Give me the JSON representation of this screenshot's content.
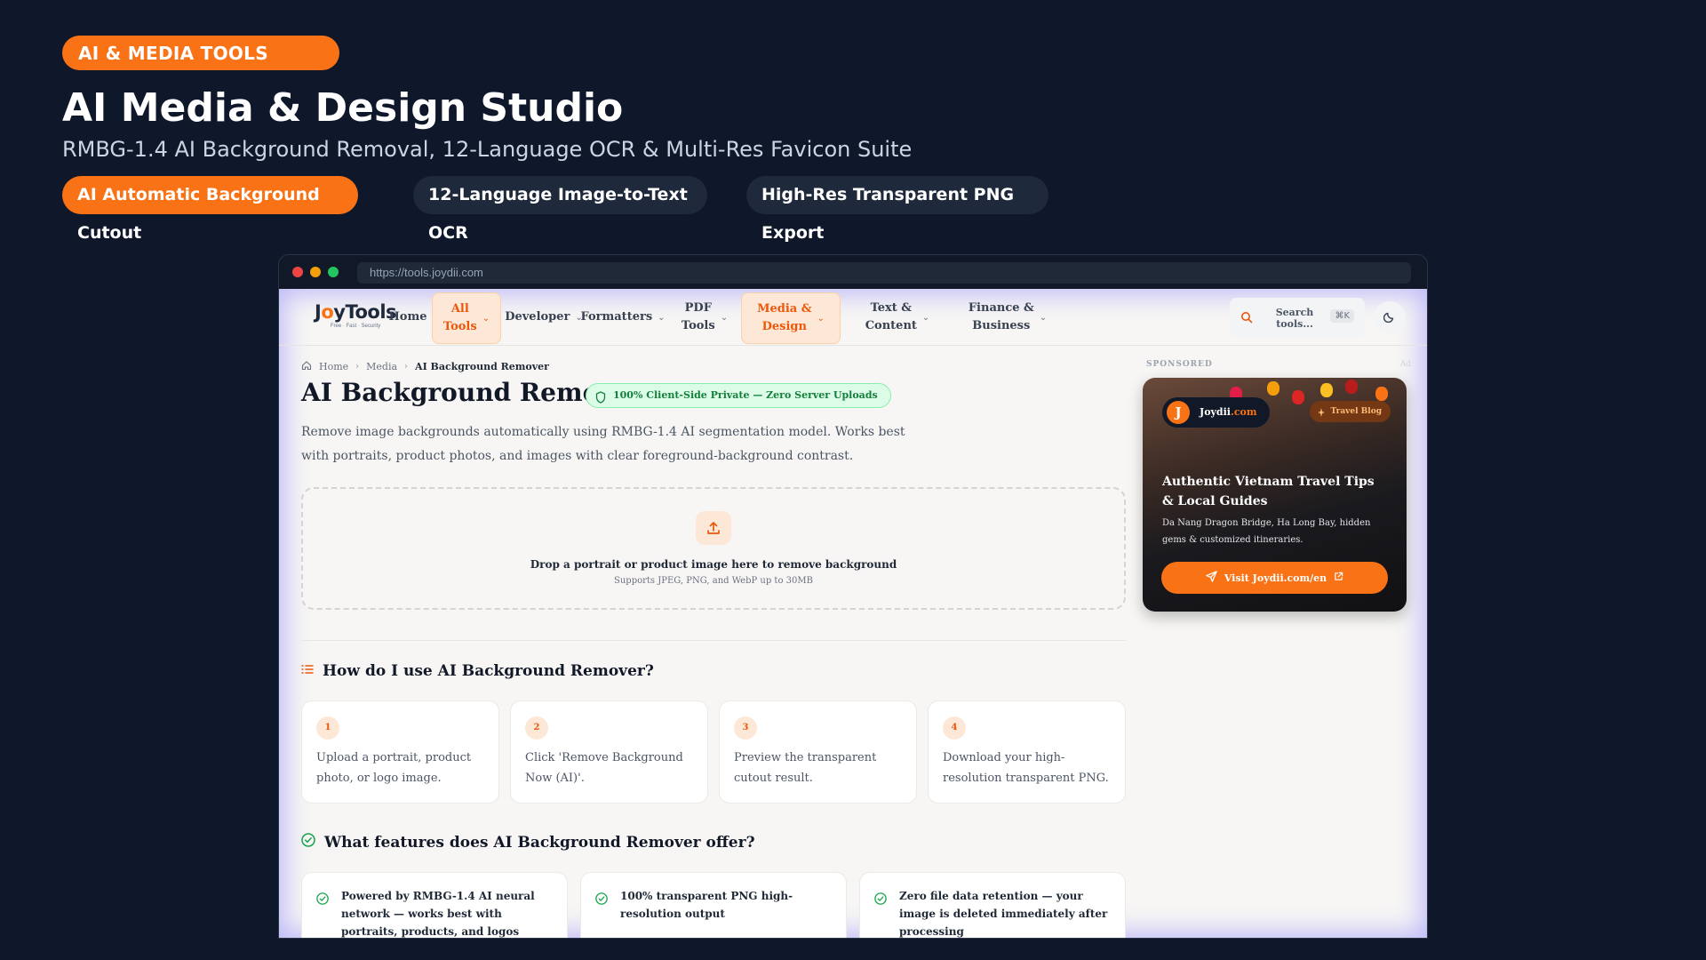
{
  "promo": {
    "badge": "AI & MEDIA TOOLS",
    "title": "AI Media & Design Studio",
    "subtitle": "RMBG-1.4 AI Background Removal, 12-Language OCR & Multi-Res Favicon Suite",
    "pills": [
      "AI Automatic Background Cutout",
      "12-Language Image-to-Text OCR",
      "High-Res Transparent PNG Export"
    ]
  },
  "browser": {
    "url": "https://tools.joydii.com"
  },
  "site": {
    "logo": {
      "part1": "J",
      "accent": "o",
      "part2": "yTools",
      "tagline": "Free · Fast · Security"
    },
    "nav": {
      "home": "Home",
      "all_tools": "All\nTools",
      "developer": "Developer",
      "formatters": "Formatters",
      "pdf_tools": "PDF\nTools",
      "media_design": "Media &\nDesign",
      "text_content": "Text &\nContent",
      "finance": "Finance &\nBusiness",
      "search_placeholder": "Search\ntools...",
      "search_shortcut": "⌘K"
    },
    "breadcrumb": [
      "Home",
      "Media",
      "AI Background Remover"
    ],
    "page_title": "AI Background Remover",
    "privacy_badge": "100% Client-Side Private — Zero Server Uploads",
    "description": "Remove image backgrounds automatically using RMBG-1.4 AI segmentation model. Works best with portraits, product photos, and images with clear foreground-background contrast.",
    "dropzone": {
      "title": "Drop a portrait or product image here to remove background",
      "subtitle": "Supports JPEG, PNG, and WebP up to 30MB"
    },
    "howto": {
      "title": "How do I use AI Background Remover?",
      "steps": [
        {
          "num": "1",
          "text": "Upload a portrait, product photo, or logo image."
        },
        {
          "num": "2",
          "text": "Click 'Remove Background Now (AI)'."
        },
        {
          "num": "3",
          "text": "Preview the transparent cutout result."
        },
        {
          "num": "4",
          "text": "Download your high-resolution transparent PNG."
        }
      ]
    },
    "features": {
      "title": "What features does AI Background Remover offer?",
      "items": [
        "Powered by RMBG-1.4 AI neural network — works best with portraits, products, and logos",
        "100% transparent PNG high-resolution output",
        "Zero file data retention — your image is deleted immediately after processing"
      ]
    },
    "sponsored": {
      "label": "SPONSORED",
      "ad_label": "Ad",
      "brand": "Joydii",
      "brand_suffix": ".com",
      "brand_initial": "J",
      "tag": "Travel Blog",
      "title": "Authentic Vietnam Travel Tips & Local Guides",
      "description": "Da Nang Dragon Bridge, Ha Long Bay, hidden gems & customized itineraries.",
      "cta": "Visit Joydii.com/en"
    }
  },
  "colors": {
    "accent": "#f97316",
    "background": "#0f172a",
    "page": "#f7f6f4",
    "success": "#15803d"
  }
}
